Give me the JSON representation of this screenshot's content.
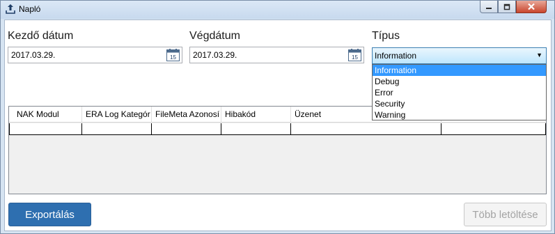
{
  "window": {
    "title": "Napló",
    "controls": {
      "minimize_icon": "minimize-icon",
      "maximize_icon": "maximize-icon",
      "close_icon": "close-icon"
    }
  },
  "filters": {
    "start_date": {
      "label": "Kezdő dátum",
      "value": "2017.03.29.",
      "icon": "calendar-icon",
      "calendar_day": "15"
    },
    "end_date": {
      "label": "Végdátum",
      "value": "2017.03.29.",
      "icon": "calendar-icon",
      "calendar_day": "15"
    },
    "type": {
      "label": "Típus",
      "selected": "Information",
      "options": [
        "Information",
        "Debug",
        "Error",
        "Security",
        "Warning"
      ],
      "open": true
    }
  },
  "grid": {
    "columns": [
      "NAK Modul",
      "ERA Log Kategór",
      "FileMeta Azonosí",
      "Hibakód",
      "Üzenet"
    ],
    "rows": [
      [
        "",
        "",
        "",
        "",
        "",
        ""
      ]
    ]
  },
  "buttons": {
    "export": "Exportálás",
    "load_more": "Több letöltése"
  },
  "colors": {
    "accent": "#2e6fb0",
    "selection": "#3399ff",
    "window_frame": "#d6e4f2"
  }
}
